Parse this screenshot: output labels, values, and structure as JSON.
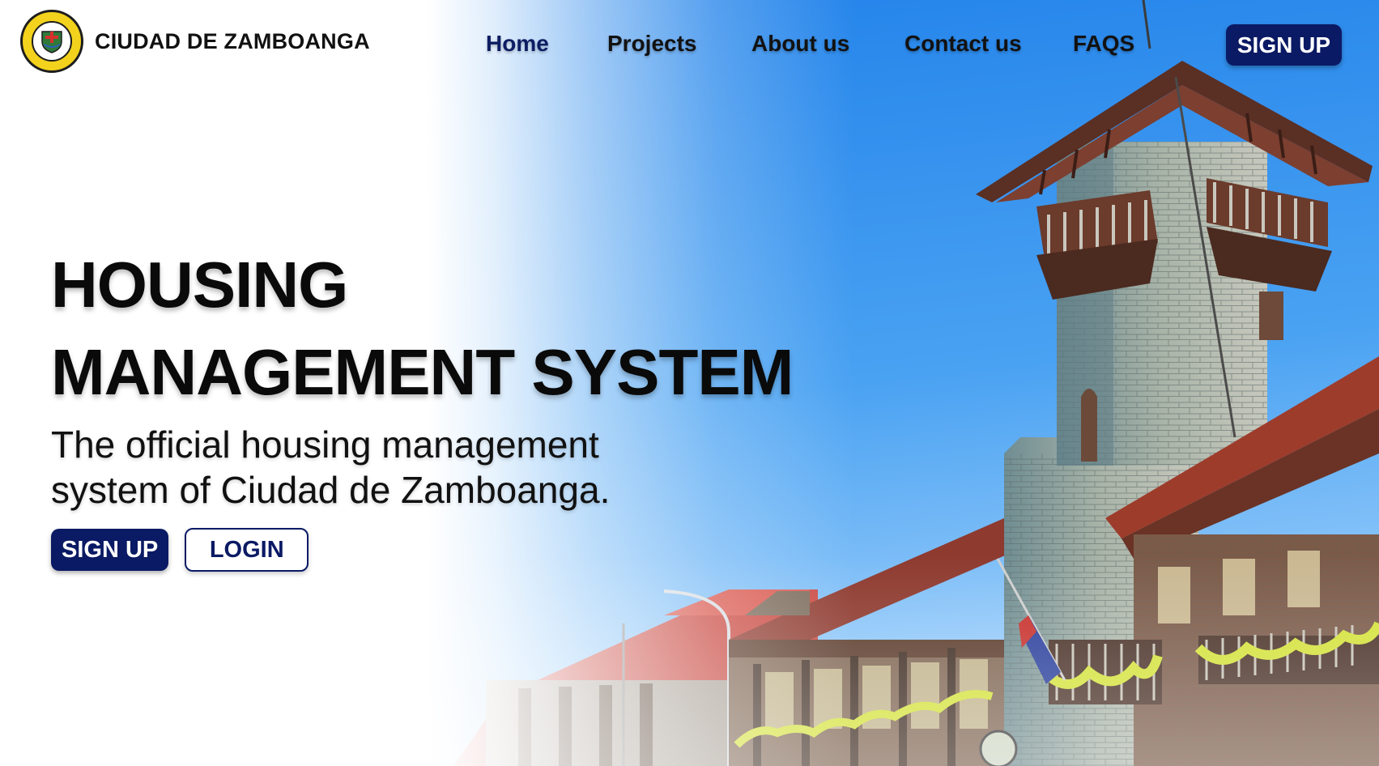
{
  "brand": {
    "name": "CIUDAD DE ZAMBOANGA",
    "seal_icon": "city-seal-icon"
  },
  "nav": {
    "items": [
      {
        "label": "Home",
        "active": true
      },
      {
        "label": "Projects",
        "active": false
      },
      {
        "label": "About us",
        "active": false
      },
      {
        "label": "Contact us",
        "active": false
      },
      {
        "label": "FAQS",
        "active": false
      }
    ],
    "signup_label": "SIGN UP"
  },
  "hero": {
    "title_line1": "HOUSING",
    "title_line2": "MANAGEMENT SYSTEM",
    "subtitle": "The official housing management system of Ciudad de Zamboanga.",
    "signup_label": "SIGN UP",
    "login_label": "LOGIN"
  },
  "colors": {
    "primary": "#0b1a64",
    "sky": "#1f86ee",
    "roof": "#b3403a",
    "text": "#0a0a0a"
  }
}
